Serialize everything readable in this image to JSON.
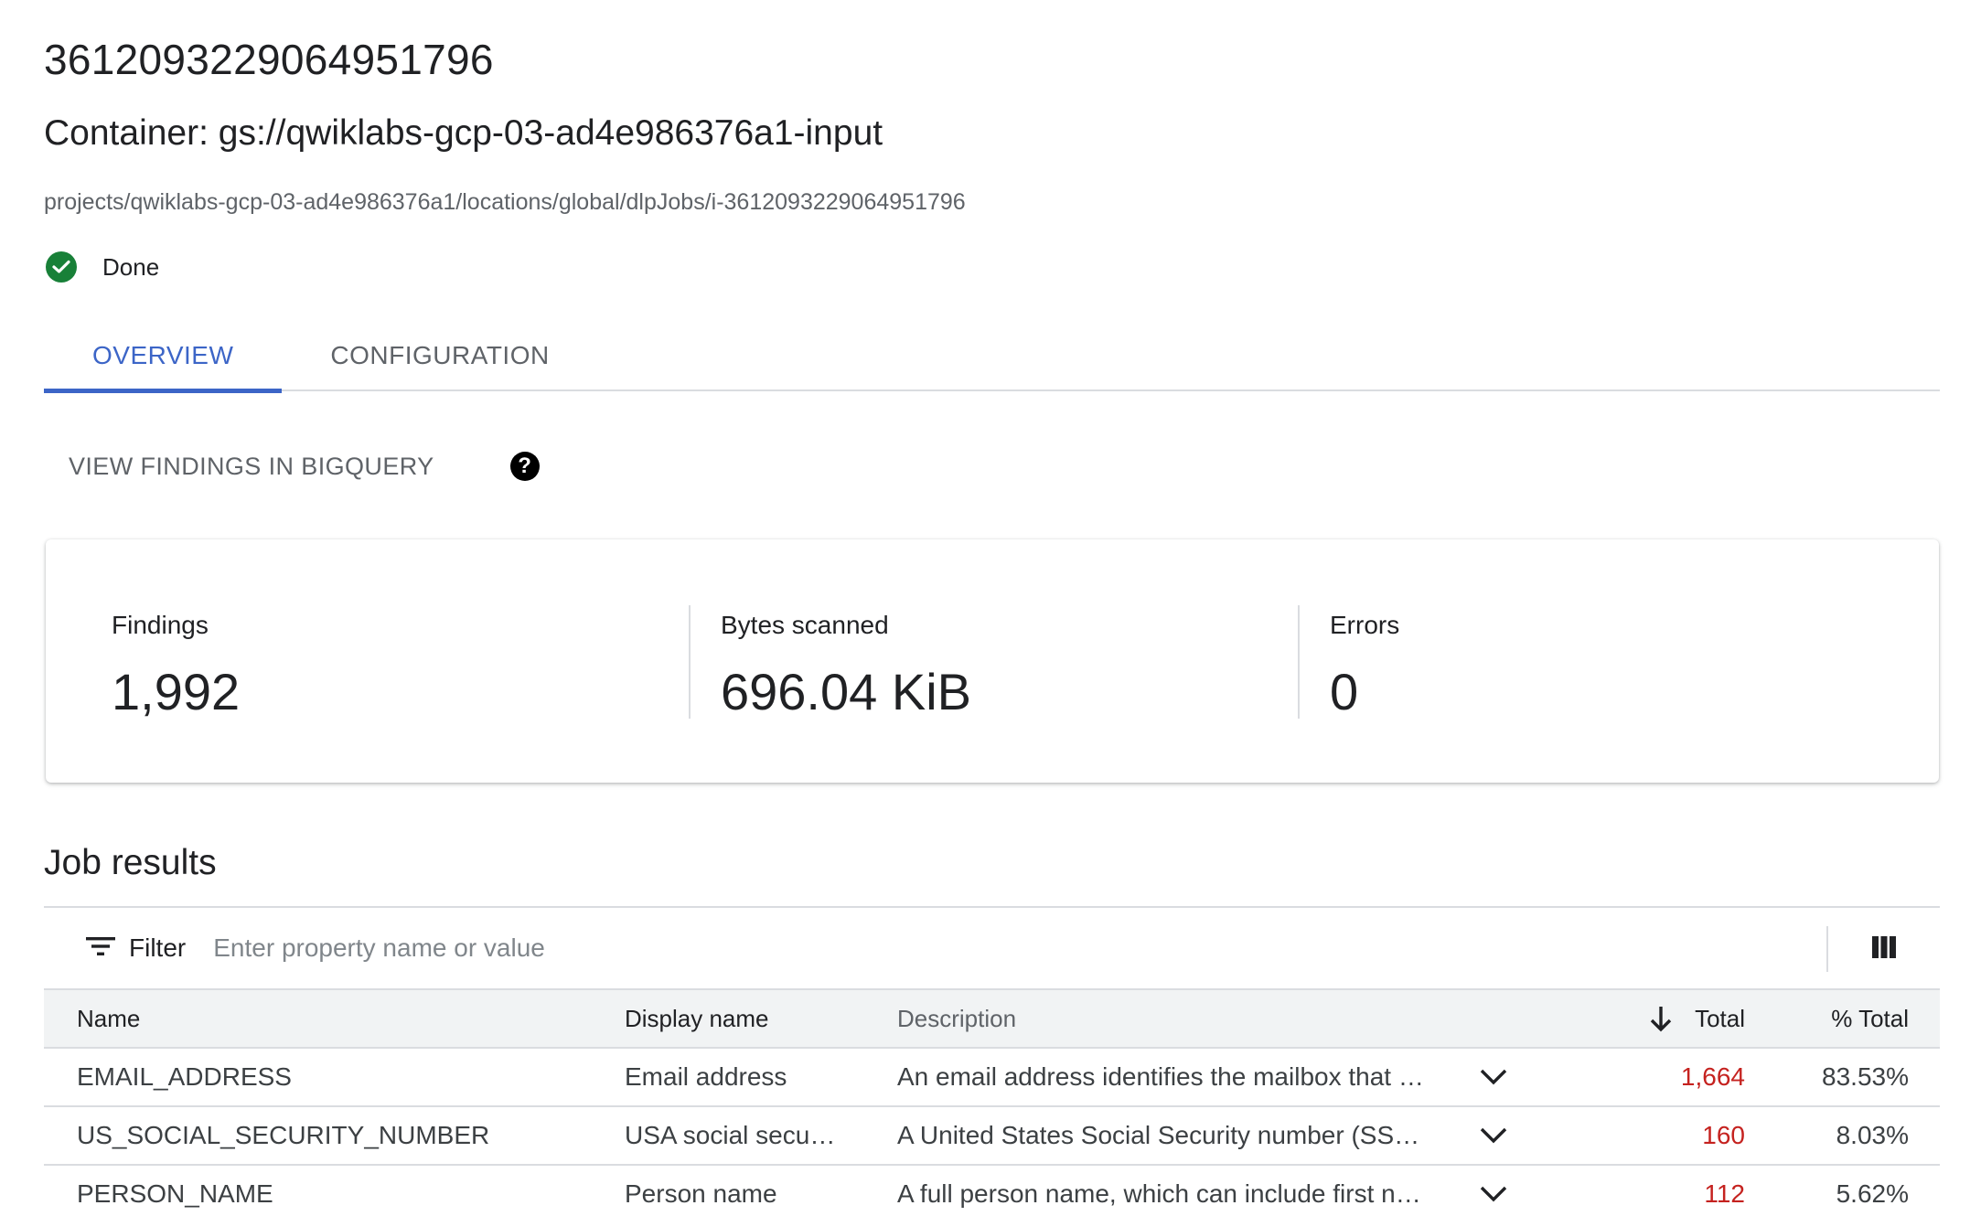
{
  "job": {
    "id": "3612093229064951796",
    "container_title": "Container: gs://qwiklabs-gcp-03-ad4e986376a1-input",
    "resource_path": "projects/qwiklabs-gcp-03-ad4e986376a1/locations/global/dlpJobs/i-3612093229064951796",
    "status": "Done",
    "status_color": "#188038"
  },
  "tabs": [
    {
      "label": "OVERVIEW",
      "active": true
    },
    {
      "label": "CONFIGURATION",
      "active": false
    }
  ],
  "accent_color": "#3c65c7",
  "actions": {
    "view_findings_label": "VIEW FINDINGS IN BIGQUERY",
    "help_icon": "help-circle-icon"
  },
  "stats": [
    {
      "label": "Findings",
      "value": "1,992"
    },
    {
      "label": "Bytes scanned",
      "value": "696.04 KiB"
    },
    {
      "label": "Errors",
      "value": "0"
    }
  ],
  "job_results": {
    "title": "Job results",
    "filter_label": "Filter",
    "filter_placeholder": "Enter property name or value",
    "columns": {
      "name": "Name",
      "display_name": "Display name",
      "description": "Description",
      "total": "Total",
      "pct_total": "% Total",
      "sort": "descending"
    },
    "rows": [
      {
        "name": "EMAIL_ADDRESS",
        "display_name": "Email address",
        "description": "An email address identifies the mailbox that …",
        "total": "1,664",
        "pct_total": "83.53%"
      },
      {
        "name": "US_SOCIAL_SECURITY_NUMBER",
        "display_name": "USA social secu…",
        "description": "A United States Social Security number (SSN…",
        "total": "160",
        "pct_total": "8.03%"
      },
      {
        "name": "PERSON_NAME",
        "display_name": "Person name",
        "description": "A full person name, which can include first n…",
        "total": "112",
        "pct_total": "5.62%"
      }
    ]
  }
}
